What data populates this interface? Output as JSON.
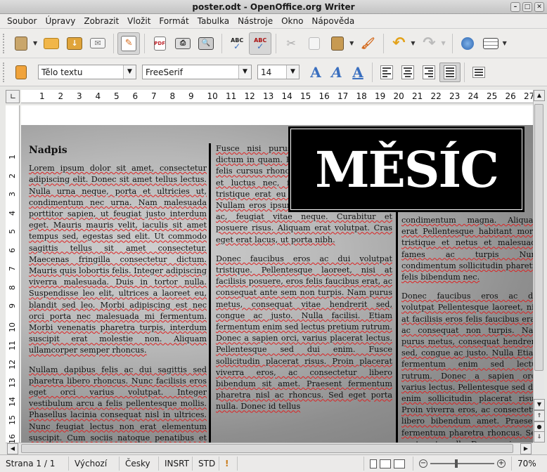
{
  "window": {
    "title": "poster.odt - OpenOffice.org Writer"
  },
  "menu": [
    "Soubor",
    "Úpravy",
    "Zobrazit",
    "Vložit",
    "Formát",
    "Tabulka",
    "Nástroje",
    "Okno",
    "Nápověda"
  ],
  "formatting": {
    "paragraph_style": "Tělo textu",
    "font_name": "FreeSerif",
    "font_size": "14",
    "bold_label": "A",
    "italic_label": "A",
    "underline_label": "A"
  },
  "ruler": {
    "horizontal": [
      "1",
      "2",
      "3",
      "4",
      "5",
      "6",
      "7",
      "8",
      "9",
      "10",
      "11",
      "12",
      "13",
      "14",
      "15",
      "16",
      "17",
      "18",
      "19",
      "20",
      "21",
      "22",
      "23",
      "24",
      "25",
      "26",
      "27"
    ],
    "vertical": [
      "1",
      "2",
      "3",
      "4",
      "5",
      "6",
      "7",
      "8",
      "9",
      "10",
      "11",
      "12",
      "13",
      "14",
      "15",
      "16"
    ]
  },
  "document": {
    "poster_title": "MĚSÍC",
    "heading": "Nadpis",
    "col1": {
      "p1": "Lorem ipsum dolor sit amet, consectetur adipiscing elit. Donec sit amet tellus lectus. Nulla urna neque, porta et ultricies ut, condimentum nec urna. Nam malesuada porttitor sapien, ut feugiat justo interdum eget. Mauris mauris velit, iaculis sit amet tempus sed, egestas sed elit. Ut commodo sagittis tellus sit amet consectetur. Maecenas fringilla consectetur dictum. Mauris quis lobortis felis. Integer adipiscing viverra malesuada. Duis in tortor nulla. Suspendisse leo elit, ultrices a laoreet eu, blandit sed leo. Morbi adipiscing est nec orci porta nec malesuada mi fermentum. Morbi venenatis pharetra turpis, interdum suscipit erat molestie non. Aliquam ullamcorper semper rhoncus.",
      "p2": "Nullam dapibus felis ac dui sagittis sed pharetra libero rhoncus. Nunc facilisis eros eget orci varius volutpat. Integer vestibulum arcu a felis pellentesque mollis. Phasellus lacinia consequat nisl in ultrices. Nunc feugiat lectus non erat elementum suscipit. Cum sociis natoque penatibus et magnis dis parturient montes,"
    },
    "col2": {
      "p1": "Fusce nisi purus, auctor et mollis ut, dictum in quam. Fusce commodo massa ac felis cursus rhoncus. Sed velit elit, viverra et luctus nec, iaculis sed leo. Integer tristique erat eu odio dictum vestibulum. Nullam eros ipsum, pretium ac malesuada ac, feugiat vitae neque. Curabitur et posuere risus. Aliquam erat volutpat. Cras eget erat lacus, ut porta nibh.",
      "p2": "Donec faucibus eros ac dui volutpat tristique. Pellentesque laoreet, nisi at facilisis posuere, eros felis faucibus erat, ac consequat ante sem non turpis. Nam purus metus, consequat vitae hendrerit sed, congue ac justo. Nulla facilisi. Etiam fermentum enim sed lectus pretium rutrum. Donec a sapien orci, varius placerat lectus. Pellentesque sed dui enim. Fusce sollicitudin placerat risus. Proin placerat viverra eros, ac consectetur libero bibendum sit amet. Praesent fermentum pharetra nisl ac rhoncus. Sed eget porta nulla. Donec id tellus"
    },
    "col3": {
      "p1": "condimentum magna. Aliquam erat Pellentesque habitant morbi tristique et netus et malesuada fames ac turpis Nunc condimentum sollicitudin pharetra felis bibendum nec.",
      "p2": "Donec faucibus eros ac dui volutpat Pellentesque laoreet, nisi at facilisis eros felis faucibus erat, ac consequat non turpis. Nam purus metus, consequat hendrerit sed, congue ac justo. Nulla Etiam fermentum enim sed lectus rutrum. Donec a sapien orci, varius lectus. Pellentesque sed dui enim sollicitudin placerat risus. Proin viverra eros, ac consectetur libero bibendum amet. Praesent fermentum pharetra rhoncus. Sed eget porta nulla. Donec quis quam euismod suscipit a Pellentesque habitant morbi tristique"
    }
  },
  "status": {
    "page": "Strana 1 / 1",
    "page_style": "Výchozí",
    "language": "Česky",
    "insert_mode": "INSRT",
    "selection_mode": "STD",
    "zoom": "70%"
  },
  "colors": {
    "accent_blue": "#3a6fbf",
    "spell_underline": "#dd2222"
  }
}
